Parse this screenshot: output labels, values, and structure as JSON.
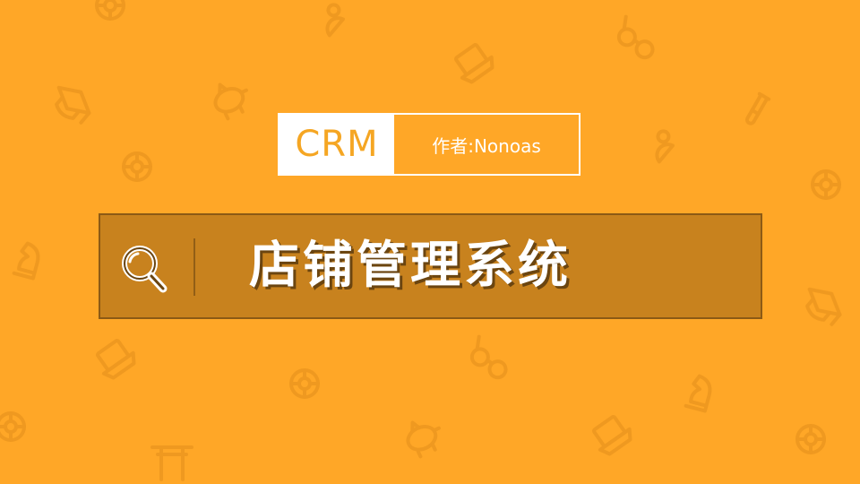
{
  "slide": {
    "badge": {
      "left_text": "CRM",
      "right_text": "作者:Nonoas"
    },
    "banner": {
      "title": "店铺管理系统",
      "icon": "magnifier-icon"
    }
  },
  "colors": {
    "background": "#FFA727",
    "pattern": "#E38F1B",
    "banner_fill": "#C8821E",
    "banner_border": "#8C5A15",
    "badge_text": "#F5A623",
    "text_light": "#FFFFFF"
  },
  "decorations": {
    "pattern_icons": [
      "ring-icon",
      "person-icon",
      "glasses-icon",
      "laptop-icon",
      "mortarboard-icon",
      "piggy-bank-icon",
      "test-tube-icon",
      "chess-knight-icon",
      "torii-icon"
    ]
  }
}
